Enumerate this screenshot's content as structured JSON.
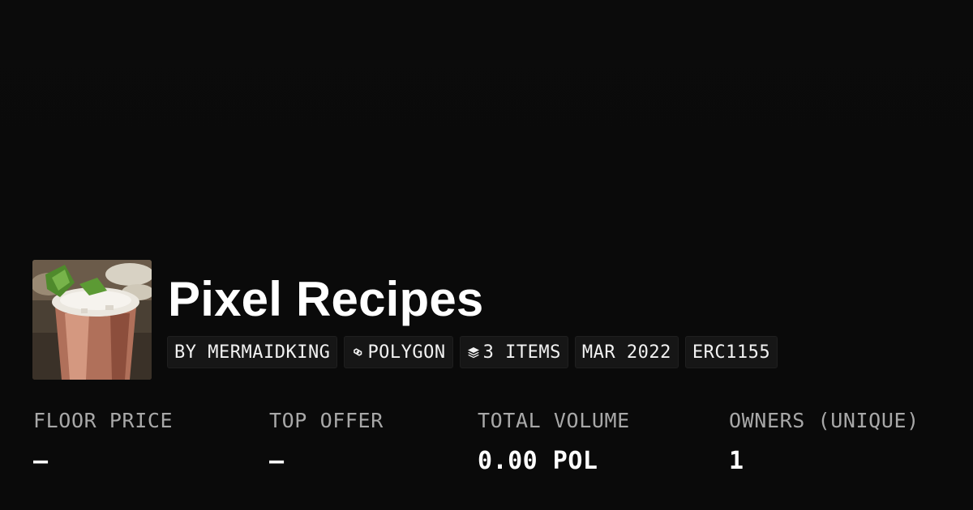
{
  "collection": {
    "title": "Pixel Recipes",
    "chips": {
      "creator": "BY MERMAIDKING",
      "chain": "POLYGON",
      "items": "3 ITEMS",
      "date": "MAR 2022",
      "standard": "ERC1155"
    },
    "avatar_icon": "pixel-art-copper-mug-image"
  },
  "stats": [
    {
      "label": "FLOOR PRICE",
      "value": "–"
    },
    {
      "label": "TOP OFFER",
      "value": "–"
    },
    {
      "label": "TOTAL VOLUME",
      "value": "0.00 POL"
    },
    {
      "label": "OWNERS (UNIQUE)",
      "value": "1"
    }
  ],
  "colors": {
    "background": "#0a0a0a",
    "chip_background": "#161616",
    "label_gray": "#a8a8a8",
    "text_white": "#ffffff"
  }
}
